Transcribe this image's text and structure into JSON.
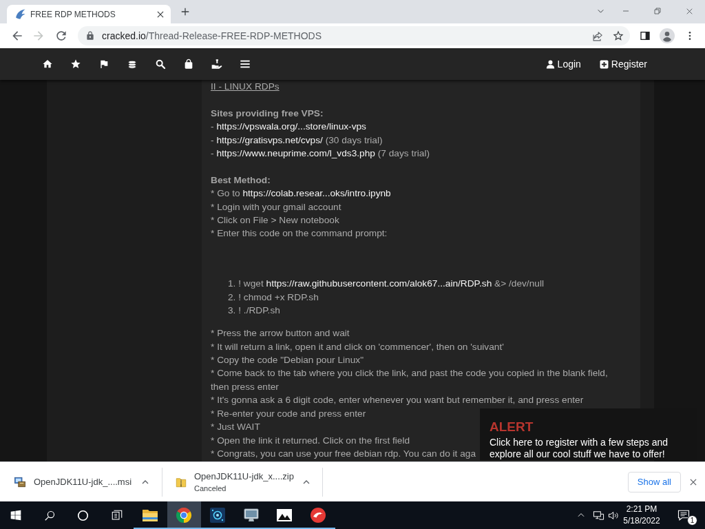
{
  "browser": {
    "tabs": [
      {
        "title": "FREE RDP METHODS",
        "selected": true
      }
    ],
    "nav_buttons": [
      {
        "kind": "back",
        "disabled": false
      },
      {
        "kind": "forward",
        "disabled": true
      },
      {
        "kind": "reload",
        "disabled": false
      }
    ],
    "address": {
      "host": "cracked.io",
      "path": "/Thread-Release-FREE-RDP-METHODS"
    }
  },
  "site_nav": {
    "links": [
      {
        "kind": "user",
        "label": "Login"
      },
      {
        "kind": "plus",
        "label": "Register"
      }
    ]
  },
  "post": {
    "blocks": [
      {
        "kind": "heading",
        "text": "II - LINUX RDPs"
      },
      {
        "kind": "paragraph",
        "lines": [
          {
            "kind": "label",
            "parts": [
              {
                "kind": "text",
                "text": "Sites providing free VPS:"
              }
            ]
          },
          {
            "kind": "text",
            "parts": [
              {
                "kind": "text",
                "text": "-"
              },
              {
                "kind": "link",
                "text": "https://vpswala.org/...store/linux-vps"
              }
            ]
          },
          {
            "kind": "text",
            "parts": [
              {
                "kind": "text",
                "text": "-"
              },
              {
                "kind": "link",
                "text": "https://gratisvps.net/cvps/"
              },
              {
                "kind": "text",
                "text": "(30 days trial)"
              }
            ]
          },
          {
            "kind": "text",
            "parts": [
              {
                "kind": "text",
                "text": "-"
              },
              {
                "kind": "link",
                "text": "https://www.neuprime.com/l_vds3.php"
              },
              {
                "kind": "text",
                "text": "(7 days trial)"
              }
            ]
          }
        ]
      },
      {
        "kind": "paragraph",
        "lines": [
          {
            "kind": "label",
            "parts": [
              {
                "kind": "text",
                "text": "Best Method:"
              }
            ]
          },
          {
            "kind": "text",
            "parts": [
              {
                "kind": "text",
                "text": "* Go to"
              },
              {
                "kind": "link",
                "text": "https://colab.resear...oks/intro.ipynb"
              }
            ]
          },
          {
            "kind": "text",
            "parts": [
              {
                "kind": "text",
                "text": "* Login with your gmail account"
              }
            ]
          },
          {
            "kind": "text",
            "parts": [
              {
                "kind": "text",
                "text": "* Click on File > New notebook"
              }
            ]
          },
          {
            "kind": "text",
            "parts": [
              {
                "kind": "text",
                "text": "* Enter this code on the command prompt:"
              }
            ]
          }
        ]
      },
      {
        "kind": "steps",
        "items": [
          {
            "number": "1.",
            "parts": [
              {
                "kind": "text",
                "text": "! wget"
              },
              {
                "kind": "link",
                "text": "https://raw.githubusercontent.com/alok67...ain/RDP.sh"
              },
              {
                "kind": "text",
                "text": "&> /dev/null"
              }
            ]
          },
          {
            "number": "2.",
            "parts": [
              {
                "kind": "text",
                "text": "! chmod +x RDP.sh"
              }
            ]
          },
          {
            "number": "3.",
            "parts": [
              {
                "kind": "text",
                "text": "! ./RDP.sh"
              }
            ]
          }
        ]
      },
      {
        "kind": "paragraph",
        "lines": [
          {
            "kind": "text",
            "parts": [
              {
                "kind": "text",
                "text": "* Press the arrow button and wait"
              }
            ]
          },
          {
            "kind": "text",
            "parts": [
              {
                "kind": "text",
                "text": "* It will return a link, open it and click on 'commencer', then on 'suivant'"
              }
            ]
          },
          {
            "kind": "text",
            "parts": [
              {
                "kind": "text",
                "text": "* Copy the code \"Debian pour Linux\""
              }
            ]
          },
          {
            "kind": "text",
            "parts": [
              {
                "kind": "text",
                "text": "* Come back to the tab where you click the link, and past the code you copied in the blank field, then press enter"
              }
            ]
          },
          {
            "kind": "text",
            "parts": [
              {
                "kind": "text",
                "text": "* It's gonna ask a 6 digit code, enter whenever you want but remember it, and press enter"
              }
            ]
          },
          {
            "kind": "text",
            "parts": [
              {
                "kind": "text",
                "text": "* Re-enter your code and press enter"
              }
            ]
          },
          {
            "kind": "text",
            "parts": [
              {
                "kind": "text",
                "text": "* Just WAIT"
              }
            ]
          },
          {
            "kind": "text",
            "parts": [
              {
                "kind": "text",
                "text": "* Open the link it returned. Click on the first field"
              }
            ]
          },
          {
            "kind": "text",
            "parts": [
              {
                "kind": "text",
                "text": "* Congrats, you can use your free debian rdp. You can do it aga"
              }
            ]
          }
        ]
      }
    ]
  },
  "alert": {
    "title": "ALERT",
    "message": "Click here to register with a few steps and explore all our cool stuff we have to offer!"
  },
  "downloads": {
    "items": [
      {
        "kind": "installer",
        "name": "OpenJDK11U-jdk_....msi"
      },
      {
        "kind": "archive",
        "name": "OpenJDK11U-jdk_x....zip",
        "status": "Canceled"
      }
    ],
    "show_all": "Show all"
  },
  "taskbar": {
    "apps": [
      {
        "kind": "folder",
        "running": true,
        "active": false
      },
      {
        "kind": "browser",
        "running": true,
        "active": true
      },
      {
        "kind": "ring-app",
        "running": true,
        "active": false
      },
      {
        "kind": "monitor",
        "running": true,
        "active": false
      },
      {
        "kind": "picture",
        "running": true,
        "active": false
      },
      {
        "kind": "round-logo",
        "running": true,
        "active": false
      }
    ],
    "clock": {
      "time": "2:21 PM",
      "date": "5/18/2022"
    },
    "notification_count": "1"
  }
}
